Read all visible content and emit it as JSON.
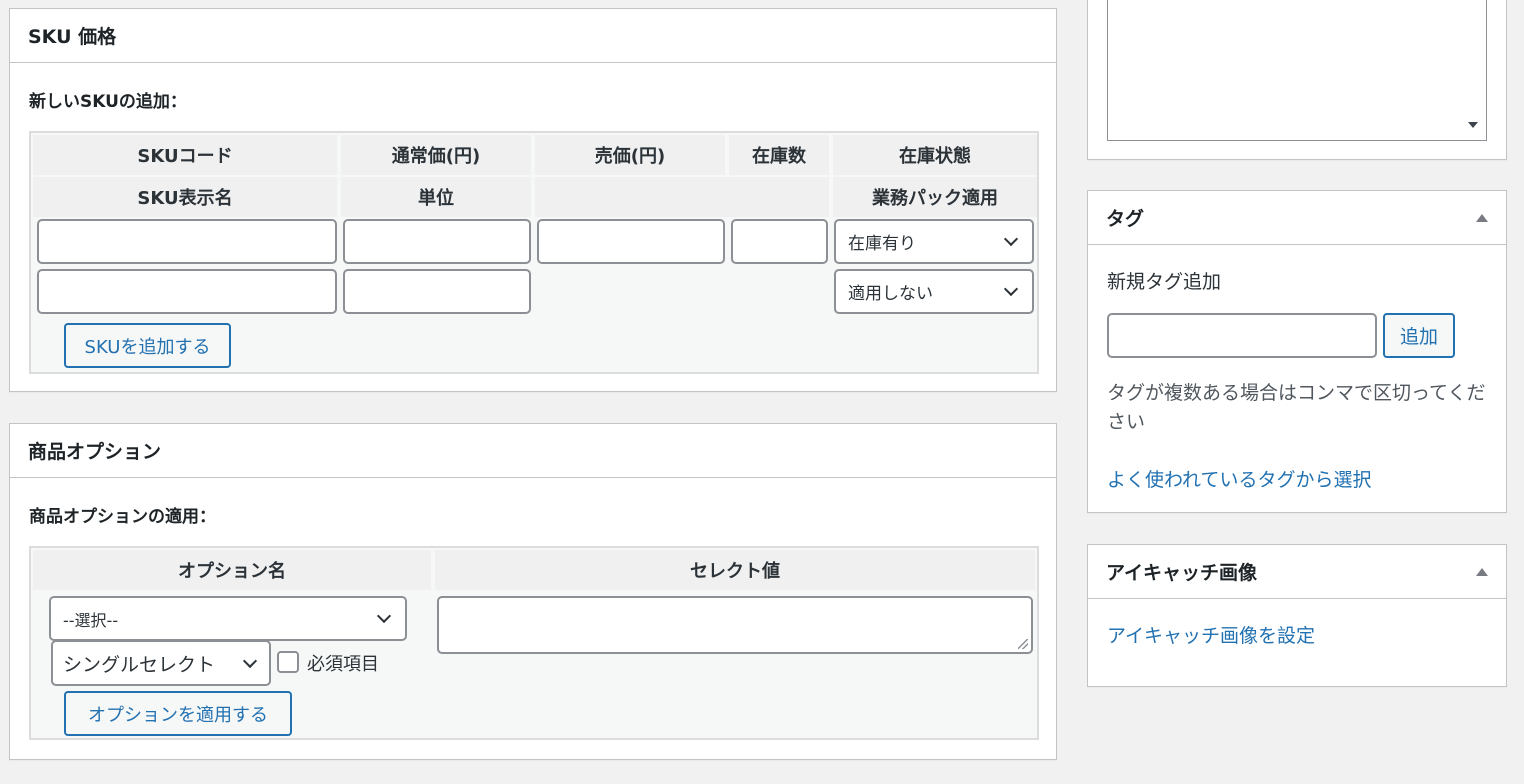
{
  "sku_box": {
    "title": "SKU 価格",
    "add_label": "新しいSKUの追加：",
    "headers_row1": [
      "SKUコード",
      "通常価(円)",
      "売価(円)",
      "在庫数",
      "在庫状態"
    ],
    "headers_row2": [
      "SKU表示名",
      "単位",
      "業務パック適用"
    ],
    "stock_status_value": "在庫有り",
    "pack_value": "適用しない",
    "add_button": "SKUを追加する"
  },
  "option_box": {
    "title": "商品オプション",
    "apply_label": "商品オプションの適用：",
    "header_option_name": "オプション名",
    "header_select_value": "セレクト値",
    "option_select_value": "--選択--",
    "type_select_value": "シングルセレクト",
    "required_label": "必須項目",
    "apply_button": "オプションを適用する"
  },
  "tag_box": {
    "title": "タグ",
    "new_tag_label": "新規タグ追加",
    "add_button": "追加",
    "hint": "タグが複数ある場合はコンマで区切ってください",
    "popular_link": "よく使われているタグから選択"
  },
  "eyecatch_box": {
    "title": "アイキャッチ画像",
    "set_link": "アイキャッチ画像を設定"
  }
}
